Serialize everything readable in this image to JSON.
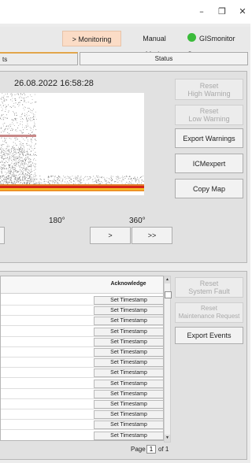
{
  "window": {
    "minimize_glyph": "–",
    "maximize_glyph": "❐",
    "close_glyph": "✕"
  },
  "modebar": {
    "monitoring_label": "> Monitoring Mode",
    "manual_label": "Manual Mode",
    "server_label": "GISmonitor Server",
    "server_status_color": "#3bbb3b"
  },
  "tabs": {
    "left_partial": "ts",
    "status": "Status"
  },
  "map": {
    "timestamp": "26.08.2022 16:58:28",
    "axis_180": "180°",
    "axis_360": "360°"
  },
  "nav": {
    "next_label": ">",
    "last_label": ">>"
  },
  "side_buttons": {
    "reset_high": "Reset\nHigh Warning",
    "reset_low": "Reset\nLow Warning",
    "export_warnings": "Export Warnings",
    "icmexpert": "ICMexpert",
    "copy_map": "Copy Map"
  },
  "events": {
    "acknowledge_header": "Acknowledge",
    "rows": [
      "Set Timestamp",
      "Set Timestamp",
      "Set Timestamp",
      "Set Timestamp",
      "Set Timestamp",
      "Set Timestamp",
      "Set Timestamp",
      "Set Timestamp",
      "Set Timestamp",
      "Set Timestamp",
      "Set Timestamp",
      "Set Timestamp",
      "Set Timestamp",
      "Set Timestamp"
    ],
    "reset_fault": "Reset\nSystem Fault",
    "reset_maint": "Reset\nMaintenance Request",
    "export_events": "Export Events",
    "page_label": "Page",
    "page_value": "1",
    "page_of": "of 1"
  }
}
